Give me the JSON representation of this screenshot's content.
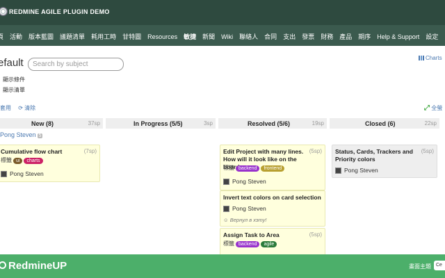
{
  "header": {
    "title": "REDMINE AGILE PLUGIN DEMO"
  },
  "menu": {
    "items": [
      "頁",
      "活動",
      "版本藍圖",
      "議題清單",
      "耗用工時",
      "甘特圖",
      "Resources",
      "敏捷",
      "新聞",
      "Wiki",
      "聯絡人",
      "合同",
      "支出",
      "發票",
      "財務",
      "產品",
      "期序",
      "Help & Support",
      "設定"
    ],
    "active": "敏捷"
  },
  "page": {
    "title": "efault",
    "search_placeholder": "Search by subject",
    "charts_label": "Charts",
    "option1": "顯示條件",
    "option2": "顯示清單",
    "filter_apply": "套用",
    "filter_clear": "清除",
    "fullscreen": "全螢"
  },
  "columns": [
    {
      "name": "New (8)",
      "sp": "37sp"
    },
    {
      "name": "In Progress (5/5)",
      "sp": "3sp"
    },
    {
      "name": "Resolved (5/6)",
      "sp": "19sp"
    },
    {
      "name": "Closed (6)",
      "sp": "22sp"
    }
  ],
  "swimlane": {
    "name": "Pong Steven",
    "count": "5"
  },
  "tag_label": "標籤",
  "cards": [
    {
      "subject": "Cumulative flow chart",
      "sp": "(7sp)",
      "tags": [
        "ui",
        "charts"
      ],
      "user": "Pong Steven"
    },
    {
      "subject": "Edit Project with many lines. How will it look like on the board",
      "sp": "(5sp)",
      "tags": [
        "backend",
        "frontend"
      ],
      "user": "Pong Steven"
    },
    {
      "subject": "Invert text colors on card selection",
      "user": "Pong Steven",
      "comment": "Вернул в хэту!"
    },
    {
      "subject": "Assign Task to Area",
      "sp": "(5sp)",
      "tags": [
        "backend",
        "agile"
      ]
    },
    {
      "subject": "Status, Cards, Trackers and Priority colors",
      "sp": "(5sp)",
      "user": "Pong Steven"
    }
  ],
  "footer": {
    "brand": "RedmineUP",
    "theme": "畫面主題",
    "button": "Ce"
  },
  "colors": {
    "topbar": "#2e4a3f",
    "menubar": "#3b5a4e",
    "footer": "#4caf6a",
    "tag_ui": "#7a5a2a",
    "tag_charts": "#cc2266",
    "tag_backend": "#9933cc",
    "tag_frontend": "#b8a030",
    "tag_agile": "#2a7a3a"
  }
}
